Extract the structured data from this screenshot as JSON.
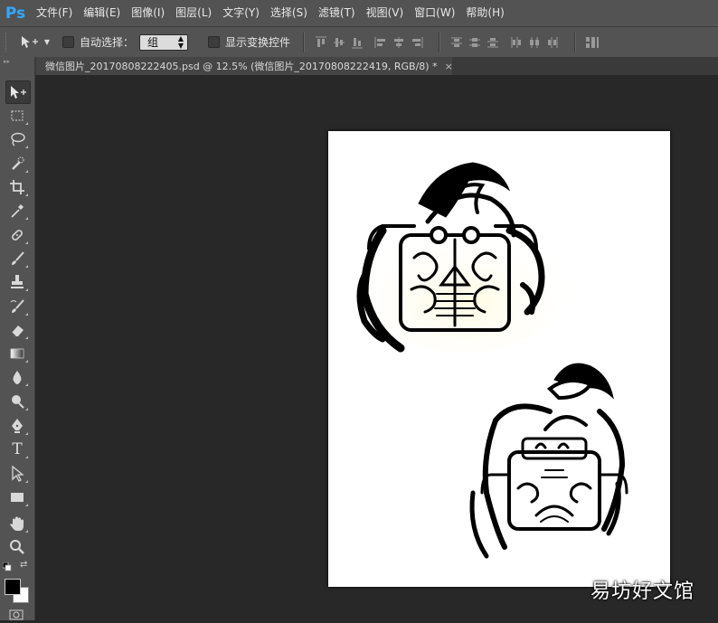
{
  "app": {
    "logo": "Ps"
  },
  "menu": [
    "文件(F)",
    "编辑(E)",
    "图像(I)",
    "图层(L)",
    "文字(Y)",
    "选择(S)",
    "滤镜(T)",
    "视图(V)",
    "窗口(W)",
    "帮助(H)"
  ],
  "options": {
    "auto_select_label": "自动选择：",
    "auto_select_value": "组",
    "show_transform_label": "显示变换控件"
  },
  "document_tab": {
    "title": "微信图片_20170808222405.psd @ 12.5% (微信图片_20170808222419, RGB/8) *",
    "close": "×"
  },
  "tools": [
    "move-tool",
    "marquee-tool",
    "lasso-tool",
    "quick-selection-tool",
    "crop-tool",
    "eyedropper-tool",
    "healing-brush-tool",
    "brush-tool",
    "clone-stamp-tool",
    "history-brush-tool",
    "eraser-tool",
    "gradient-tool",
    "blur-tool",
    "dodge-tool",
    "pen-tool",
    "type-tool",
    "path-selection-tool",
    "rectangle-tool",
    "hand-tool",
    "zoom-tool"
  ],
  "type_tool_glyph": "T",
  "colors": {
    "foreground": "#000000",
    "background": "#ffffff",
    "accent": "#31a8ff"
  },
  "watermark": "易坊好文馆"
}
